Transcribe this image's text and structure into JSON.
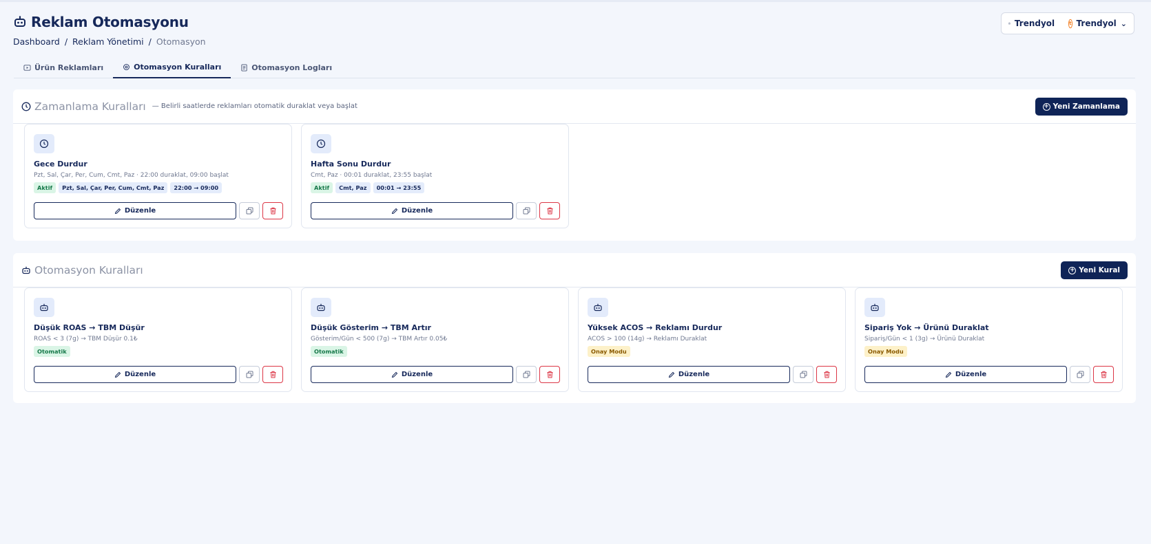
{
  "header": {
    "title": "Reklam Otomasyonu",
    "breadcrumb": [
      "Dashboard",
      "Reklam Yönetimi",
      "Otomasyon"
    ]
  },
  "store_select": {
    "store": "Trendyol",
    "marketplace": "Trendyol",
    "marketplace_logo": "t"
  },
  "tabs": [
    {
      "label": "Ürün Reklamları",
      "icon": "play-square-icon"
    },
    {
      "label": "Otomasyon Kuralları",
      "icon": "gear-icon"
    },
    {
      "label": "Otomasyon Logları",
      "icon": "document-icon"
    }
  ],
  "schedule_section": {
    "title": "Zamanlama Kuralları",
    "description": "— Belirli saatlerde reklamları otomatik duraklat veya başlat",
    "new_button": "Yeni Zamanlama",
    "cards": [
      {
        "name": "Gece Durdur",
        "desc": "Pzt, Sal, Çar, Per, Cum, Cmt, Paz · 22:00 duraklat, 09:00 başlat",
        "status": "Aktif",
        "days": "Pzt, Sal, Çar, Per, Cum, Cmt, Paz",
        "time": "22:00 → 09:00",
        "edit": "Düzenle"
      },
      {
        "name": "Hafta Sonu Durdur",
        "desc": "Cmt, Paz · 00:01 duraklat, 23:55 başlat",
        "status": "Aktif",
        "days": "Cmt, Paz",
        "time": "00:01 → 23:55",
        "edit": "Düzenle"
      }
    ]
  },
  "automation_section": {
    "title": "Otomasyon Kuralları",
    "new_button": "Yeni Kural",
    "cards": [
      {
        "name": "Düşük ROAS → TBM Düşür",
        "desc": "ROAS < 3 (7g) → TBM Düşür 0.1₺",
        "mode": "Otomatik",
        "edit": "Düzenle"
      },
      {
        "name": "Düşük Gösterim → TBM Artır",
        "desc": "Gösterim/Gün < 500 (7g) → TBM Artır 0.05₺",
        "mode": "Otomatik",
        "edit": "Düzenle"
      },
      {
        "name": "Yüksek ACOS → Reklamı Durdur",
        "desc": "ACOS > 100 (14g) → Reklamı Duraklat",
        "mode": "Onay Modu",
        "edit": "Düzenle"
      },
      {
        "name": "Sipariş Yok → Ürünü Duraklat",
        "desc": "Sipariş/Gün < 1 (3g) → Ürünü Duraklat",
        "mode": "Onay Modu",
        "edit": "Düzenle"
      }
    ]
  },
  "colors": {
    "primary": "#0f2457",
    "danger": "#dc3545",
    "success_bg": "#daf5e6",
    "warning_bg": "#fdf1c9"
  }
}
